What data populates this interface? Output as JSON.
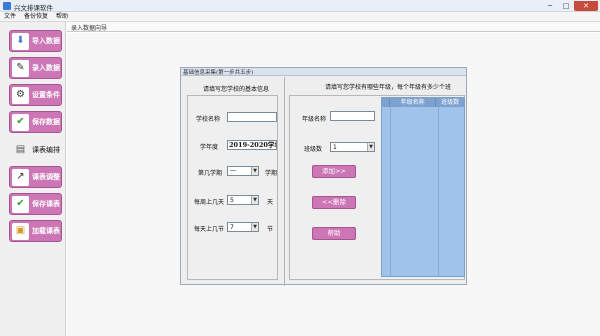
{
  "app": {
    "title": "兴文排课软件",
    "controls": {
      "minimize": "─",
      "maximize": "□",
      "close": "✕"
    }
  },
  "menu": {
    "items": [
      "文件",
      "备份恢复",
      "帮助"
    ]
  },
  "sidebar": {
    "items": [
      {
        "label": "导入数据",
        "icon": "import-icon",
        "glyph": "⬇",
        "color": "#3b7ad8"
      },
      {
        "label": "录入数据",
        "icon": "edit-form-icon",
        "glyph": "✎",
        "color": "#333333"
      },
      {
        "label": "设置条件",
        "icon": "settings-icon",
        "glyph": "⚙",
        "color": "#333333"
      },
      {
        "label": "保存数据",
        "icon": "save-icon",
        "glyph": "✔",
        "color": "#3a9a3a"
      },
      {
        "label": "课表编排",
        "icon": "printer-icon",
        "glyph": "▤",
        "color": "#555555"
      },
      {
        "label": "课表调整",
        "icon": "adjust-icon",
        "glyph": "↗",
        "color": "#333333"
      },
      {
        "label": "保存课表",
        "icon": "save-schedule-icon",
        "glyph": "✔",
        "color": "#3a9a3a"
      },
      {
        "label": "加载课表",
        "icon": "load-icon",
        "glyph": "▣",
        "color": "#d89a2a"
      }
    ]
  },
  "breadcrumb": "录入数据向导",
  "dialog": {
    "title": "基础信息采集(第一步共五步)",
    "left_title": "请填写您学校的基本信息",
    "right_title": "请填写您学校有哪些年级，每个年级有多少个班",
    "fields": {
      "school_name_label": "学校名称",
      "school_name_value": "",
      "school_year_label": "学年度",
      "school_year_value": "2019-2020学年度",
      "semester_label": "第几学期",
      "semester_value": "一",
      "semester_unit": "学期",
      "days_label": "每周上几天",
      "days_value": "5",
      "days_unit": "天",
      "periods_label": "每天上几节",
      "periods_value": "7",
      "periods_unit": "节",
      "grade_name_label": "年级名称",
      "grade_name_value": "",
      "class_count_label": "班级数",
      "class_count_value": "1"
    },
    "buttons": {
      "add": "添加>>",
      "delete": "<<删除",
      "help": "帮助"
    },
    "grid": {
      "columns": [
        "",
        "年级名称",
        "班级数"
      ]
    }
  }
}
